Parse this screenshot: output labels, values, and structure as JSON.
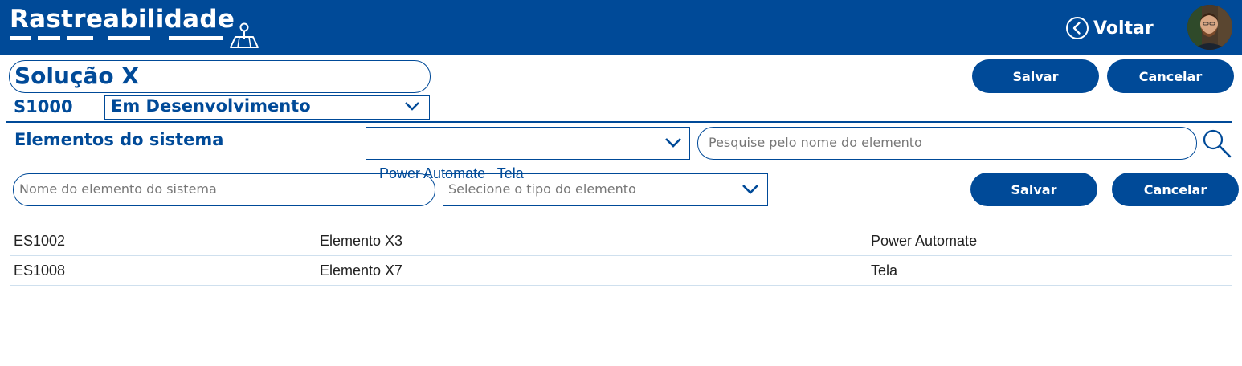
{
  "header": {
    "app_title": "Rastreabilidade",
    "back_label": "Voltar",
    "icons": [
      "map-pin-icon",
      "back-circle-icon"
    ]
  },
  "solution": {
    "name": "Solução X",
    "code": "S1000",
    "status": "Em Desenvolvimento",
    "save_label": "Salvar",
    "cancel_label": "Cancelar"
  },
  "elements": {
    "title": "Elementos do sistema",
    "filter_selected": "Power Automate   Tela",
    "search_placeholder": "Pesquise pelo nome do elemento",
    "name_placeholder": "Nome do elemento do sistema",
    "type_placeholder": "Selecione o tipo do elemento",
    "save_label": "Salvar",
    "cancel_label": "Cancelar",
    "rows": [
      {
        "id": "ES1002",
        "name": "Elemento X3",
        "type": "Power Automate"
      },
      {
        "id": "ES1008",
        "name": "Elemento X7",
        "type": "Tela"
      }
    ]
  },
  "colors": {
    "primary": "#004a98",
    "row_divider": "#cfe0ee",
    "placeholder": "#777777"
  }
}
